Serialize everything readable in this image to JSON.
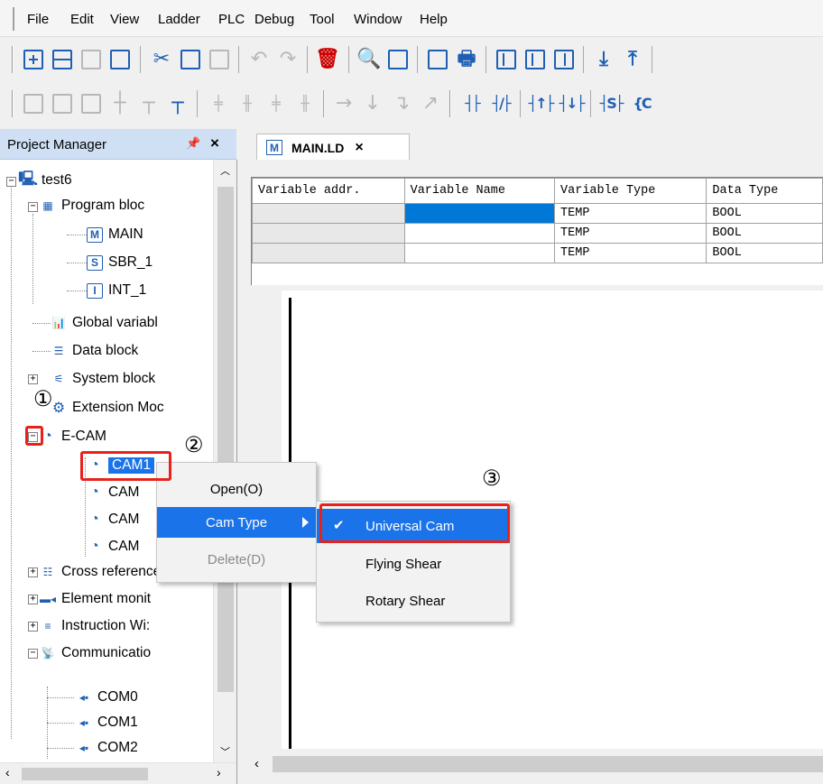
{
  "menubar": {
    "items": [
      "File",
      "Edit",
      "View",
      "Ladder",
      "PLC",
      "Debug",
      "Tool",
      "Window",
      "Help"
    ]
  },
  "project_manager": {
    "title": "Project Manager",
    "pin_glyph": "p",
    "close_glyph": "×",
    "tree": {
      "root": "test6",
      "program_block": "Program bloc",
      "main": "MAIN",
      "sbr": "SBR_1",
      "int": "INT_1",
      "global_vars": "Global variabl",
      "data_block": "Data block",
      "system_block": "System block",
      "extension": "Extension Moc",
      "ecam": "E-CAM",
      "cams": [
        "CAM1",
        "CAM",
        "CAM",
        "CAM"
      ],
      "cross_ref": "Cross reference",
      "element_monitor": "Element monit",
      "instruction_wizard": "Instruction Wi:",
      "communication": "Communicatio",
      "coms": [
        "COM0",
        "COM1",
        "COM2"
      ]
    },
    "tree_icons": {
      "main": "M",
      "sbr": "S",
      "int": "I"
    }
  },
  "editor": {
    "tab_label": "MAIN.LD",
    "tab_icon": "M",
    "tab_close": "×",
    "columns": [
      "Variable addr.",
      "Variable Name",
      "Variable Type",
      "Data Type"
    ],
    "rows": [
      {
        "addr": "",
        "name": "",
        "type": "TEMP",
        "dtype": "BOOL"
      },
      {
        "addr": "",
        "name": "",
        "type": "TEMP",
        "dtype": "BOOL"
      },
      {
        "addr": "",
        "name": "",
        "type": "TEMP",
        "dtype": "BOOL"
      }
    ]
  },
  "context_menu": {
    "open": "Open(O)",
    "cam_type": "Cam Type",
    "delete": "Delete(D)"
  },
  "submenu": {
    "universal": "Universal Cam",
    "flying": "Flying Shear",
    "rotary": "Rotary Shear",
    "check": "✔"
  },
  "annotations": {
    "one": "①",
    "two": "②",
    "three": "③"
  },
  "colors": {
    "selection": "#1a73e8",
    "annotation": "#e8221b",
    "icon_blue": "#1f5fb3"
  }
}
